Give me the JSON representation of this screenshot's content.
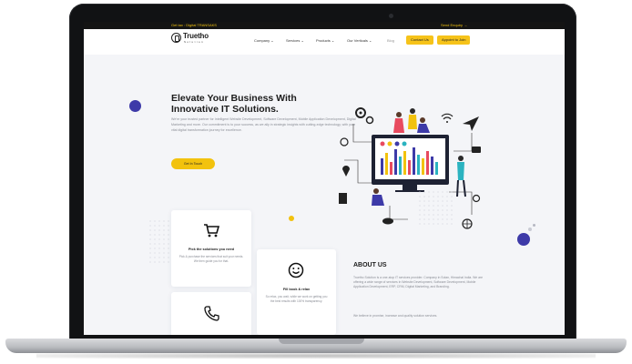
{
  "topbar": {
    "left_text": "Get tax : Digital TRANSAKS",
    "right_text": "Send Enquiry →"
  },
  "brand": {
    "name": "Truetho",
    "tagline": "Solution"
  },
  "nav": {
    "items": [
      "Company ⌄",
      "Services ⌄",
      "Products ⌄",
      "Our Verticals ⌄",
      "Blog"
    ],
    "contact_label": "Contact Us",
    "appoint_label": "Appoint to Join"
  },
  "hero": {
    "title_line1": "Elevate Your Business With",
    "title_line2": "Innovative IT Solutions.",
    "description": "We're your trusted partner for Intelligent Website Development, Software Development, Mobile Application Development, Digital Marketing and more. Our commitment is to your success, as we ally in strategic insights with cutting-edge technology, with your vital digital transformation journey for excellence.",
    "cta_label": "Get In Touch"
  },
  "cards": [
    {
      "title": "Pick the solutions you need",
      "desc": "Pick & purchase the services that suit your needs. We then guide you for that."
    },
    {
      "title": "Fill book & relax",
      "desc": "So relax, you wait, while we work on getting you the best results with 100% transparency."
    }
  ],
  "about": {
    "title": "ABOUT US",
    "desc1": "Truetho Solution is a one-stop IT services provider. Company in Solan, Himachal India. We are offering a wide range of services in Website Development, Software Development, Mobile Application Development, ERP, CRM, Digital Marketing, and Branding.",
    "desc2": "We believe in promise, increase and quality solution services."
  },
  "colors": {
    "accent": "#f2c20e",
    "dark": "#141414",
    "purple": "#3d3aa8"
  },
  "icons": [
    "cart-icon",
    "phone-icon",
    "smile-icon",
    "gear-icon",
    "wifi-icon",
    "send-icon",
    "location-icon",
    "file-icon",
    "cloud-icon",
    "globe-icon",
    "chart-icon"
  ]
}
